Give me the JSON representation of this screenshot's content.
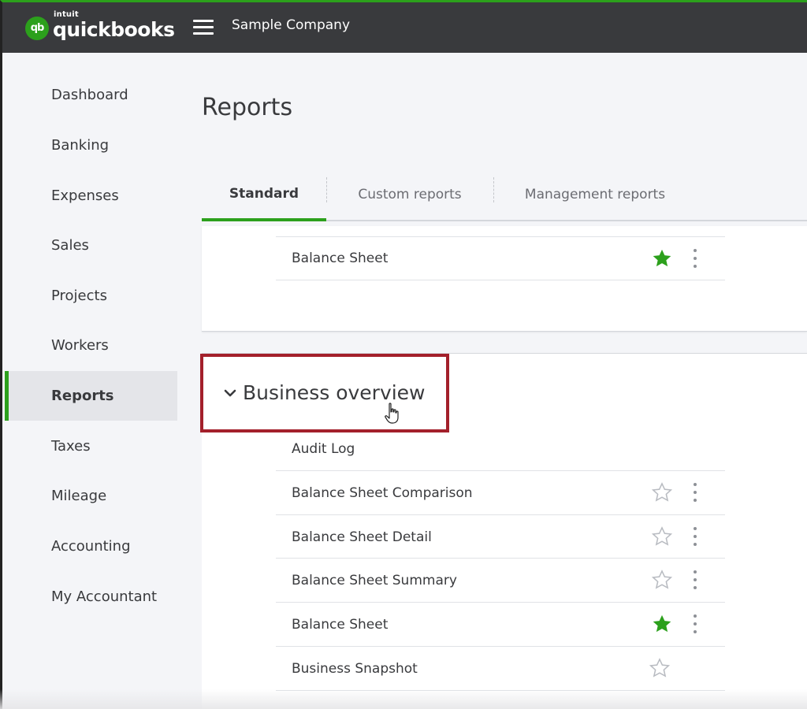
{
  "header": {
    "logo_intuit": "intuit",
    "logo_name": "quickbooks",
    "logo_badge": "qb",
    "company_name": "Sample Company"
  },
  "sidebar": {
    "items": [
      {
        "label": "Dashboard"
      },
      {
        "label": "Banking"
      },
      {
        "label": "Expenses"
      },
      {
        "label": "Sales"
      },
      {
        "label": "Projects"
      },
      {
        "label": "Workers"
      },
      {
        "label": "Reports",
        "active": true
      },
      {
        "label": "Taxes"
      },
      {
        "label": "Mileage"
      },
      {
        "label": "Accounting"
      },
      {
        "label": "My Accountant"
      }
    ]
  },
  "main": {
    "title": "Reports",
    "tabs": [
      {
        "label": "Standard",
        "active": true
      },
      {
        "label": "Custom reports"
      },
      {
        "label": "Management reports"
      }
    ],
    "favorites": [
      {
        "label": "Balance Sheet",
        "starred": true
      }
    ],
    "section": {
      "title": "Business overview",
      "expanded": true,
      "reports": [
        {
          "label": "Audit Log",
          "starred": null
        },
        {
          "label": "Balance Sheet Comparison",
          "starred": false
        },
        {
          "label": "Balance Sheet Detail",
          "starred": false
        },
        {
          "label": "Balance Sheet Summary",
          "starred": false
        },
        {
          "label": "Balance Sheet",
          "starred": true
        },
        {
          "label": "Business Snapshot",
          "starred": false
        }
      ]
    }
  },
  "colors": {
    "brand_green": "#2ca01c",
    "topbar": "#393a3d",
    "highlight_box": "#a3202b",
    "star_filled": "#2ca01c",
    "star_empty": "#b8bbc1"
  }
}
